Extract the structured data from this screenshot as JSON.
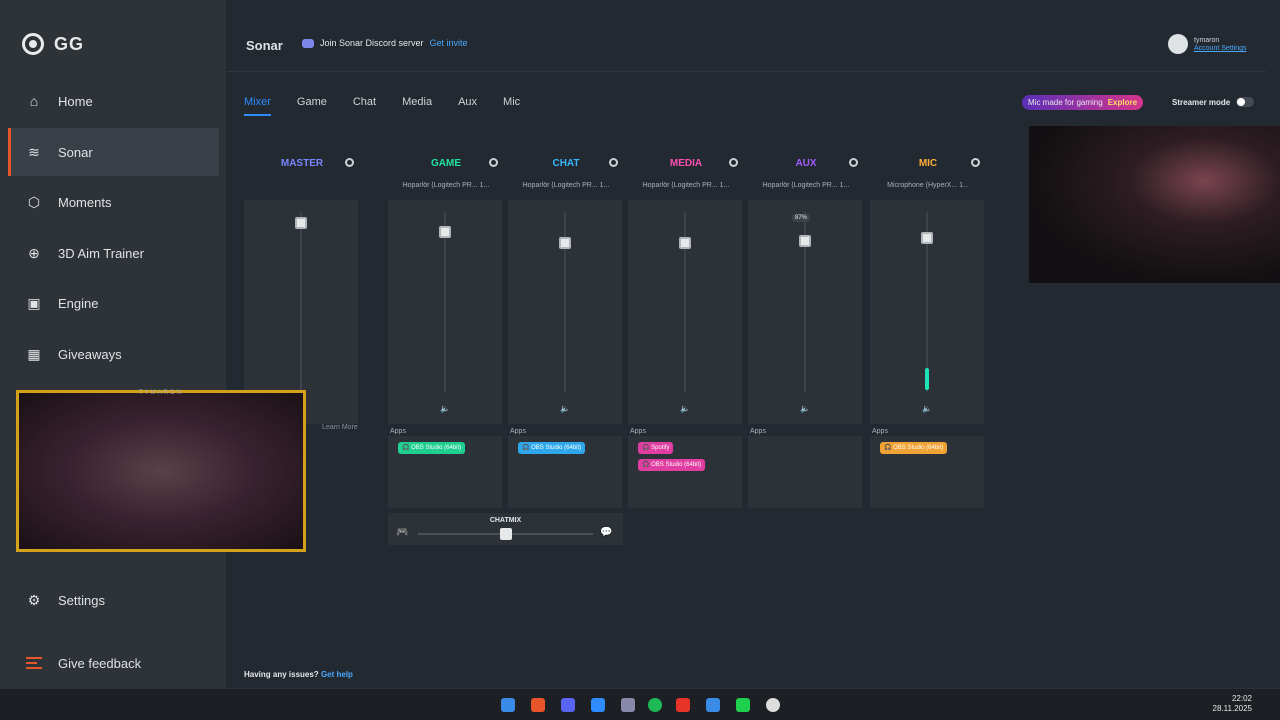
{
  "app": {
    "logo_text": "GG"
  },
  "sidebar": {
    "items": [
      {
        "label": "Home",
        "icon": "home-icon"
      },
      {
        "label": "Sonar",
        "icon": "sonar-icon",
        "active": true
      },
      {
        "label": "Moments",
        "icon": "moments-icon"
      },
      {
        "label": "3D Aim Trainer",
        "icon": "crosshair-icon"
      },
      {
        "label": "Engine",
        "icon": "chip-icon"
      },
      {
        "label": "Giveaways",
        "icon": "gift-icon"
      },
      {
        "label": "Settings",
        "icon": "gear-icon"
      },
      {
        "label": "Give feedback",
        "icon": "feedback-icon"
      }
    ]
  },
  "header": {
    "title": "Sonar",
    "discord_text": "Join Sonar Discord server",
    "discord_link": "Get invite",
    "account_name": "tymaron",
    "account_link": "Account Settings"
  },
  "tabs": [
    "Mixer",
    "Game",
    "Chat",
    "Media",
    "Aux",
    "Mic"
  ],
  "promo": {
    "text": "Mic made for gaming",
    "cta": "Explore"
  },
  "streamer_mode": {
    "label": "Streamer mode",
    "on": false
  },
  "channels": [
    {
      "name": "MASTER",
      "color": "#7a86ff",
      "device": "",
      "level": 0.97,
      "apps_label": "",
      "learn_more": "Learn More",
      "apps": []
    },
    {
      "name": "GAME",
      "color": "#1fe3a0",
      "device": "Hoparlör (Logitech PR... 1...",
      "level": 0.92,
      "apps_label": "Apps",
      "apps": [
        {
          "label": "OBS Studio (64bit)",
          "color": "#1fcf8f"
        }
      ]
    },
    {
      "name": "CHAT",
      "color": "#39b6ff",
      "device": "Hoparlör (Logitech PR... 1...",
      "level": 0.86,
      "apps_label": "Apps",
      "apps": [
        {
          "label": "OBS Studio (64bit)",
          "color": "#2ea8ea"
        }
      ]
    },
    {
      "name": "MEDIA",
      "color": "#ff4fb5",
      "device": "Hoparlör (Logitech PR... 1...",
      "level": 0.86,
      "apps_label": "Apps",
      "apps": [
        {
          "label": "Spotify",
          "color": "#e03ea0"
        },
        {
          "label": "OBS Studio (64bit)",
          "color": "#e03ea0"
        }
      ]
    },
    {
      "name": "AUX",
      "color": "#a35cff",
      "device": "Hoparlör (Logitech PR... 1...",
      "level": 0.87,
      "percent": "87%",
      "apps_label": "Apps",
      "apps": []
    },
    {
      "name": "MIC",
      "color": "#ffb03a",
      "device": "Microphone (HyperX... 1...",
      "level": 0.89,
      "apps_label": "Apps",
      "apps": [
        {
          "label": "OBS Studio (64bit)",
          "color": "#f0a234"
        }
      ]
    }
  ],
  "chatmix": {
    "label": "CHATMIX",
    "value": 0.5
  },
  "footer": {
    "issues_text": "Having any issues?",
    "help_link": "Get help"
  },
  "webcam_tag": "TYMARON",
  "taskbar": {
    "time": "22:02",
    "date": "28.11.2025"
  }
}
